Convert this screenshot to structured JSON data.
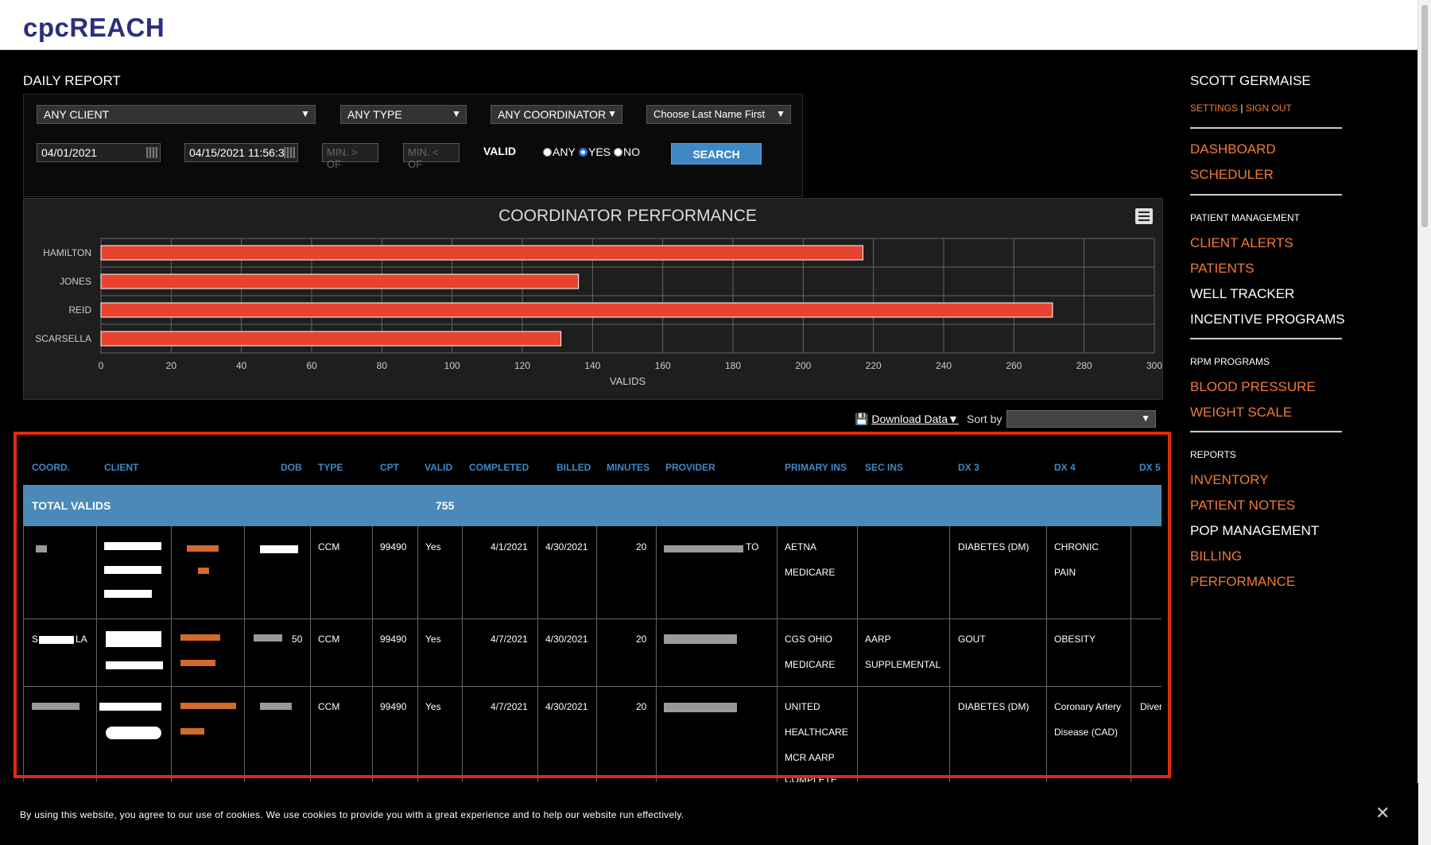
{
  "app": {
    "logo": "cpcREACH"
  },
  "page": {
    "title": "DAILY REPORT"
  },
  "filters": {
    "client": "ANY CLIENT",
    "type": "ANY TYPE",
    "coordinator": "ANY COORDINATOR",
    "order": "Choose Last Name First",
    "date_from": "04/01/2021",
    "date_to": "04/15/2021 11:56:3",
    "min_gt_placeholder": "MIN. > OF",
    "min_lt_placeholder": "MIN. < OF",
    "valid_label": "VALID",
    "radio_any": "ANY",
    "radio_yes": "YES",
    "radio_no": "NO",
    "search_label": "SEARCH"
  },
  "chart_data": {
    "type": "bar",
    "orientation": "horizontal",
    "title": "COORDINATOR PERFORMANCE",
    "xlabel": "VALIDS",
    "ylabel": "",
    "categories": [
      "HAMILTON",
      "JONES",
      "REID",
      "SCARSELLA"
    ],
    "values": [
      217,
      136,
      271,
      131
    ],
    "xlim": [
      0,
      300
    ],
    "xticks": [
      0,
      20,
      40,
      60,
      80,
      100,
      120,
      140,
      160,
      180,
      200,
      220,
      240,
      260,
      280,
      300
    ],
    "grid": true,
    "bar_color": "#e8432f"
  },
  "table_tools": {
    "download_label": "Download Data▼",
    "sort_label": "Sort by"
  },
  "table": {
    "headers": [
      "COORD.",
      "CLIENT",
      "DOB",
      "TYPE",
      "CPT",
      "VALID",
      "COMPLETED",
      "BILLED",
      "MINUTES",
      "PROVIDER",
      "PRIMARY INS",
      "SEC INS",
      "DX 3",
      "DX 4",
      "DX 5"
    ],
    "total_label": "TOTAL VALIDS",
    "total_value": "755",
    "rows": [
      {
        "type": "CCM",
        "cpt": "99490",
        "valid": "Yes",
        "completed": "4/1/2021",
        "billed": "4/30/2021",
        "minutes": "20",
        "provider_suffix": "TO",
        "primary_ins": [
          "AETNA",
          "MEDICARE"
        ],
        "sec_ins": [],
        "dx3": [
          "DIABETES (DM)"
        ],
        "dx4": [
          "CHRONIC",
          "PAIN"
        ],
        "dx5": []
      },
      {
        "coord_fragment_a": "S",
        "coord_fragment_b": "LA",
        "dob_fragment": "50",
        "type": "CCM",
        "cpt": "99490",
        "valid": "Yes",
        "completed": "4/7/2021",
        "billed": "4/30/2021",
        "minutes": "20",
        "primary_ins": [
          "CGS OHIO",
          "MEDICARE"
        ],
        "sec_ins": [
          "AARP",
          "SUPPLEMENTAL"
        ],
        "dx3": [
          "GOUT"
        ],
        "dx4": [
          "OBESITY"
        ],
        "dx5": []
      },
      {
        "type": "CCM",
        "cpt": "99490",
        "valid": "Yes",
        "completed": "4/7/2021",
        "billed": "4/30/2021",
        "minutes": "20",
        "primary_ins": [
          "UNITED",
          "HEALTHCARE",
          "MCR AARP",
          "COMPLETE"
        ],
        "sec_ins": [],
        "dx3": [
          "DIABETES (DM)"
        ],
        "dx4": [
          "Coronary Artery",
          "Disease (CAD)"
        ],
        "dx5": [
          "Diver"
        ]
      }
    ]
  },
  "sidebar": {
    "user_name": "SCOTT GERMAISE",
    "settings": "SETTINGS",
    "sign_out": "SIGN OUT",
    "dashboard": "DASHBOARD",
    "scheduler": "SCHEDULER",
    "section_patient": "PATIENT MANAGEMENT",
    "client_alerts": "CLIENT ALERTS",
    "patients": "PATIENTS",
    "well_tracker": "WELL TRACKER",
    "incentive_programs": "INCENTIVE PROGRAMS",
    "section_rpm": "RPM PROGRAMS",
    "blood_pressure": "BLOOD PRESSURE",
    "weight_scale": "WEIGHT SCALE",
    "section_reports": "REPORTS",
    "inventory": "INVENTORY",
    "patient_notes": "PATIENT NOTES",
    "pop_management": "POP MANAGEMENT",
    "billing": "BILLING",
    "performance": "PERFORMANCE"
  },
  "cookie": {
    "text": "By using this website, you agree to our use of cookies. We use cookies to provide you with a great experience and to help our website run effectively.",
    "close": "✕"
  }
}
